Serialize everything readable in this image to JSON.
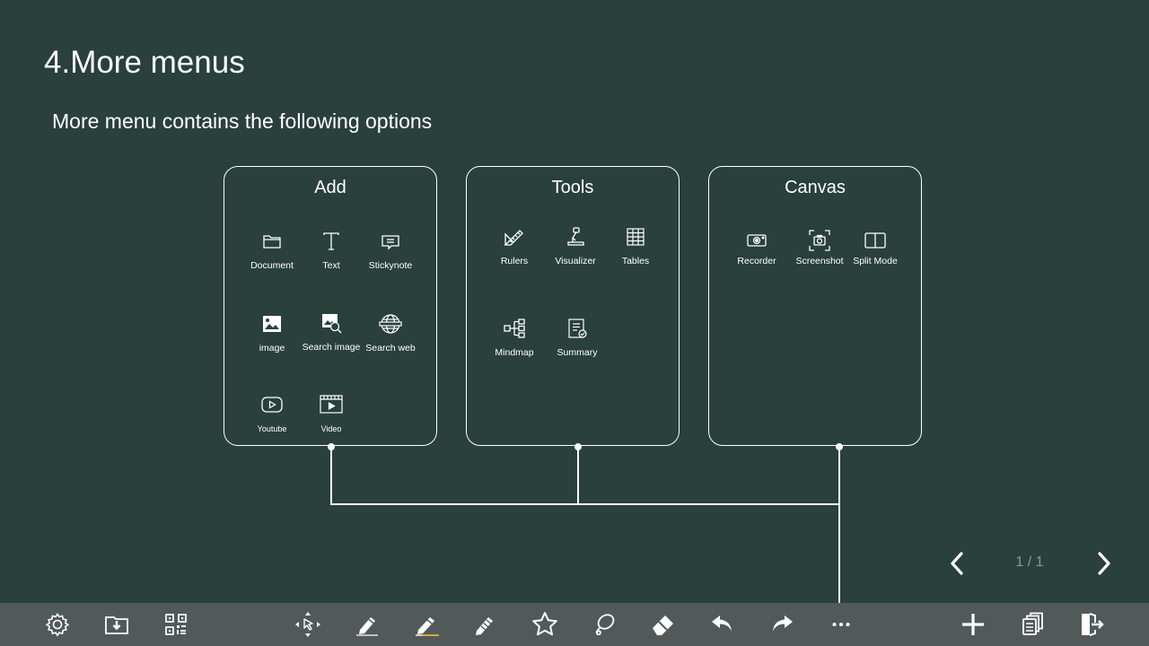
{
  "page": {
    "title": "4.More menus",
    "subtitle": "More menu contains the following options"
  },
  "panels": {
    "add": {
      "title": "Add",
      "items": [
        {
          "label": "Document",
          "icon": "folder-icon"
        },
        {
          "label": "Text",
          "icon": "text-icon"
        },
        {
          "label": "Stickynote",
          "icon": "stickynote-icon"
        },
        {
          "label": "image",
          "icon": "image-icon"
        },
        {
          "label": "Search image",
          "icon": "search-image-icon"
        },
        {
          "label": "Search web",
          "icon": "globe-icon"
        },
        {
          "label": "Youtube",
          "icon": "youtube-icon"
        },
        {
          "label": "Video",
          "icon": "video-icon"
        }
      ]
    },
    "tools": {
      "title": "Tools",
      "items": [
        {
          "label": "Rulers",
          "icon": "ruler-icon"
        },
        {
          "label": "Visualizer",
          "icon": "visualizer-icon"
        },
        {
          "label": "Tables",
          "icon": "table-icon"
        },
        {
          "label": "Mindmap",
          "icon": "mindmap-icon"
        },
        {
          "label": "Summary",
          "icon": "summary-icon"
        }
      ]
    },
    "canvas": {
      "title": "Canvas",
      "items": [
        {
          "label": "Recorder",
          "icon": "recorder-icon"
        },
        {
          "label": "Screenshot",
          "icon": "screenshot-icon"
        },
        {
          "label": "Split Mode",
          "icon": "split-mode-icon"
        }
      ]
    }
  },
  "pager": {
    "text": "1 / 1",
    "prev_icon": "chevron-left-icon",
    "next_icon": "chevron-right-icon"
  },
  "toolbar": {
    "left": [
      "settings-icon",
      "save-folder-icon",
      "qr-code-icon"
    ],
    "center": [
      "move-select-icon",
      "pen-icon",
      "highlighter-icon",
      "brush-icon",
      "shape-star-icon",
      "lasso-icon",
      "eraser-icon",
      "undo-icon",
      "redo-icon",
      "more-icon"
    ],
    "right": [
      "add-page-icon",
      "pages-icon",
      "exit-icon"
    ]
  },
  "colors": {
    "background": "#29403b",
    "toolbar": "#525a59",
    "foreground": "#ffffff",
    "highlighter_accent": "#e3b53b",
    "pager_text": "#8a9a96"
  }
}
